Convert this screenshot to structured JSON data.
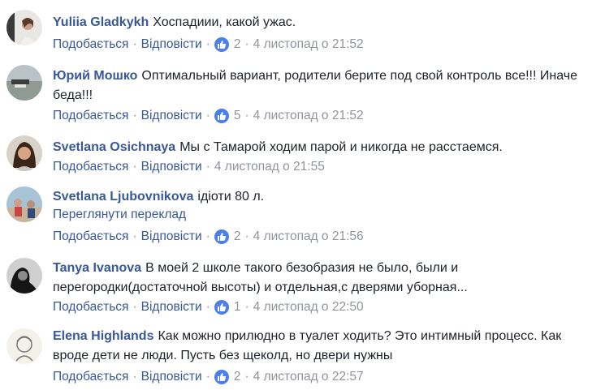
{
  "comments": [
    {
      "author": "Yuliia Gladkykh",
      "text": "Хоспадиии, какой ужас.",
      "like_label": "Подобається",
      "reply_label": "Відповісти",
      "likes": "2",
      "time": "4 листопад о 21:52"
    },
    {
      "author": "Юрий Мошко",
      "text": "Оптимальный вариант, родители берите под свой контроль все!!! Иначе беда!!!",
      "like_label": "Подобається",
      "reply_label": "Відповісти",
      "likes": "5",
      "time": "4 листопад о 21:52"
    },
    {
      "author": "Svetlana Osichnaya",
      "text": "Мы с Тамарой ходим парой и никогда не расстаемся.",
      "like_label": "Подобається",
      "reply_label": "Відповісти",
      "likes": "",
      "time": "4 листопад о 21:55"
    },
    {
      "author": "Svetlana Ljubovnikova",
      "text": "ідіоти 80 л.",
      "translate_label": "Переглянути переклад",
      "like_label": "Подобається",
      "reply_label": "Відповісти",
      "likes": "2",
      "time": "4 листопад о 21:56"
    },
    {
      "author": "Tanya Ivanova",
      "text": "В моей 2 школе такого безобразия не было, были и перегородки(достаточной высоты) и отдельная,с дверями уборная...",
      "like_label": "Подобається",
      "reply_label": "Відповісти",
      "likes": "1",
      "time": "4 листопад о 22:50"
    },
    {
      "author": "Elena Highlands",
      "text": "Как можно прилюдно в туалет ходить? Это интимный процесс. Как вроде дети не люди. Пусть без щеколд, но двери нужны",
      "like_label": "Подобається",
      "reply_label": "Відповісти",
      "likes": "2",
      "time": "4 листопад о 22:57"
    }
  ],
  "separator": "·",
  "colors": {
    "author": "#385898",
    "meta": "#90949c",
    "like_badge": "#4a80e8"
  }
}
